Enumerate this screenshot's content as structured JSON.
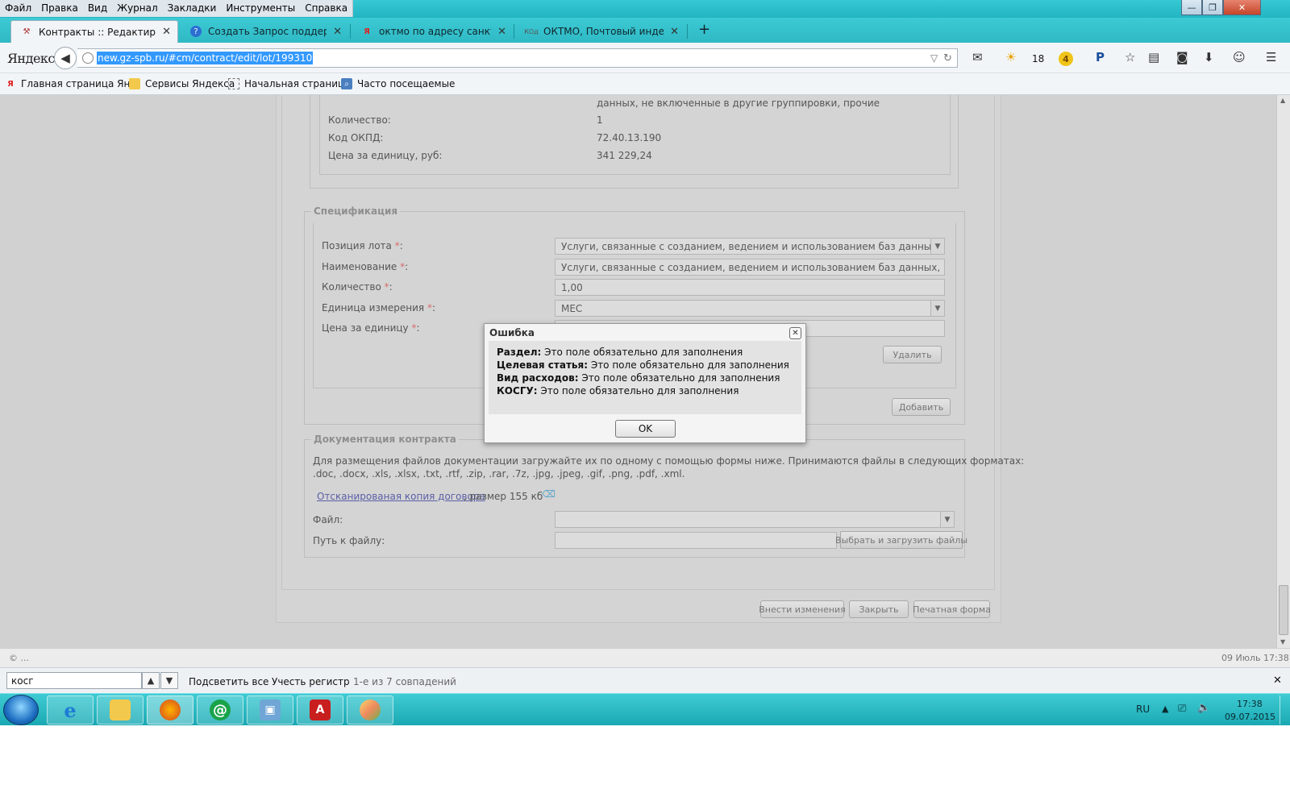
{
  "menubar": [
    "Файл",
    "Правка",
    "Вид",
    "Журнал",
    "Закладки",
    "Инструменты",
    "Справка"
  ],
  "window_controls": {
    "minimize": "—",
    "maximize": "❐",
    "close": "✕"
  },
  "tabs": [
    {
      "label": "Контракты :: Редактирова...",
      "close": "✕"
    },
    {
      "label": "Создать Запрос поддержк...",
      "close": "✕"
    },
    {
      "label": "октмо по адресу санкт-пе...",
      "close": "✕"
    },
    {
      "label": "ОКТМО, Почтовый индек...",
      "close": "✕"
    }
  ],
  "new_tab": "+",
  "navbar": {
    "logo": "Яндекс",
    "url": "new.gz-spb.ru/#cm/contract/edit/lot/199310",
    "weather_temp": "18",
    "badge_count": "4"
  },
  "bookmarks": [
    {
      "icon": "Я",
      "label": "Главная страница Ян..."
    },
    {
      "icon": "folder",
      "label": "Сервисы Яндекса"
    },
    {
      "icon": "page",
      "label": "Начальная страница"
    },
    {
      "icon": "history",
      "label": "Часто посещаемые"
    }
  ],
  "lot_details": {
    "overflow_text": "данных, не включенные в другие группировки, прочие",
    "rows": [
      {
        "label": "Количество:",
        "value": "1"
      },
      {
        "label": "Код ОКПД:",
        "value": "72.40.13.190"
      },
      {
        "label": "Цена за единицу, руб:",
        "value": "341 229,24"
      }
    ]
  },
  "specification": {
    "legend": "Спецификация",
    "position_label": "Позиция лота",
    "position_value": "Услуги, связанные с созданием, ведением и использованием баз данных, не вклю",
    "name_label": "Наименование",
    "name_value": "Услуги, связанные с созданием, ведением и использованием баз данных, не включе",
    "qty_label": "Количество",
    "qty_value": "1,00",
    "unit_label": "Единица измерения",
    "unit_value": "МЕС",
    "price_label": "Цена за единицу",
    "required_mark": "*",
    "colon": ":",
    "delete_button": "Удалить",
    "add_button": "Добавить"
  },
  "documentation": {
    "legend": "Документация контракта",
    "info_line1": "Для размещения файлов документации загружайте их по одному с помощью формы ниже. Принимаются файлы в следующих форматах:",
    "info_line2": ".doc, .docx, .xls, .xlsx, .txt, .rtf, .zip, .rar, .7z, .jpg, .jpeg, .gif, .png, .pdf, .xml.",
    "file_link": "Отсканированая копия договора",
    "file_size": ", размер 155 кб",
    "file_label": "Файл:",
    "path_label": "Путь к файлу:",
    "upload_button": "Выбрать и загрузить файлы"
  },
  "footer_buttons": {
    "save": "Внести изменения",
    "close": "Закрыть",
    "print": "Печатная форма"
  },
  "dialog": {
    "title": "Ошибка",
    "close": "✕",
    "messages": [
      {
        "field": "Раздел:",
        "text": " Это поле обязательно для заполнения"
      },
      {
        "field": "Целевая статья:",
        "text": " Это поле обязательно для заполнения"
      },
      {
        "field": "Вид расходов:",
        "text": " Это поле обязательно для заполнения"
      },
      {
        "field": "КОСГУ:",
        "text": " Это поле обязательно для заполнения"
      }
    ],
    "ok_button": "OK"
  },
  "statusbar": {
    "left": "© ...",
    "right": "09 Июль 17:38"
  },
  "findbar": {
    "query": "косг",
    "highlight_all": "Подсветить все",
    "match_case": "Учесть регистр",
    "result": "1-е из 7 совпадений",
    "close": "✕"
  },
  "taskbar": {
    "apps": [
      "ie",
      "explorer",
      "firefox",
      "mail-agent",
      "remote-desktop",
      "acrobat",
      "paint"
    ],
    "lang": "RU",
    "time": "17:38",
    "date": "09.07.2015"
  }
}
